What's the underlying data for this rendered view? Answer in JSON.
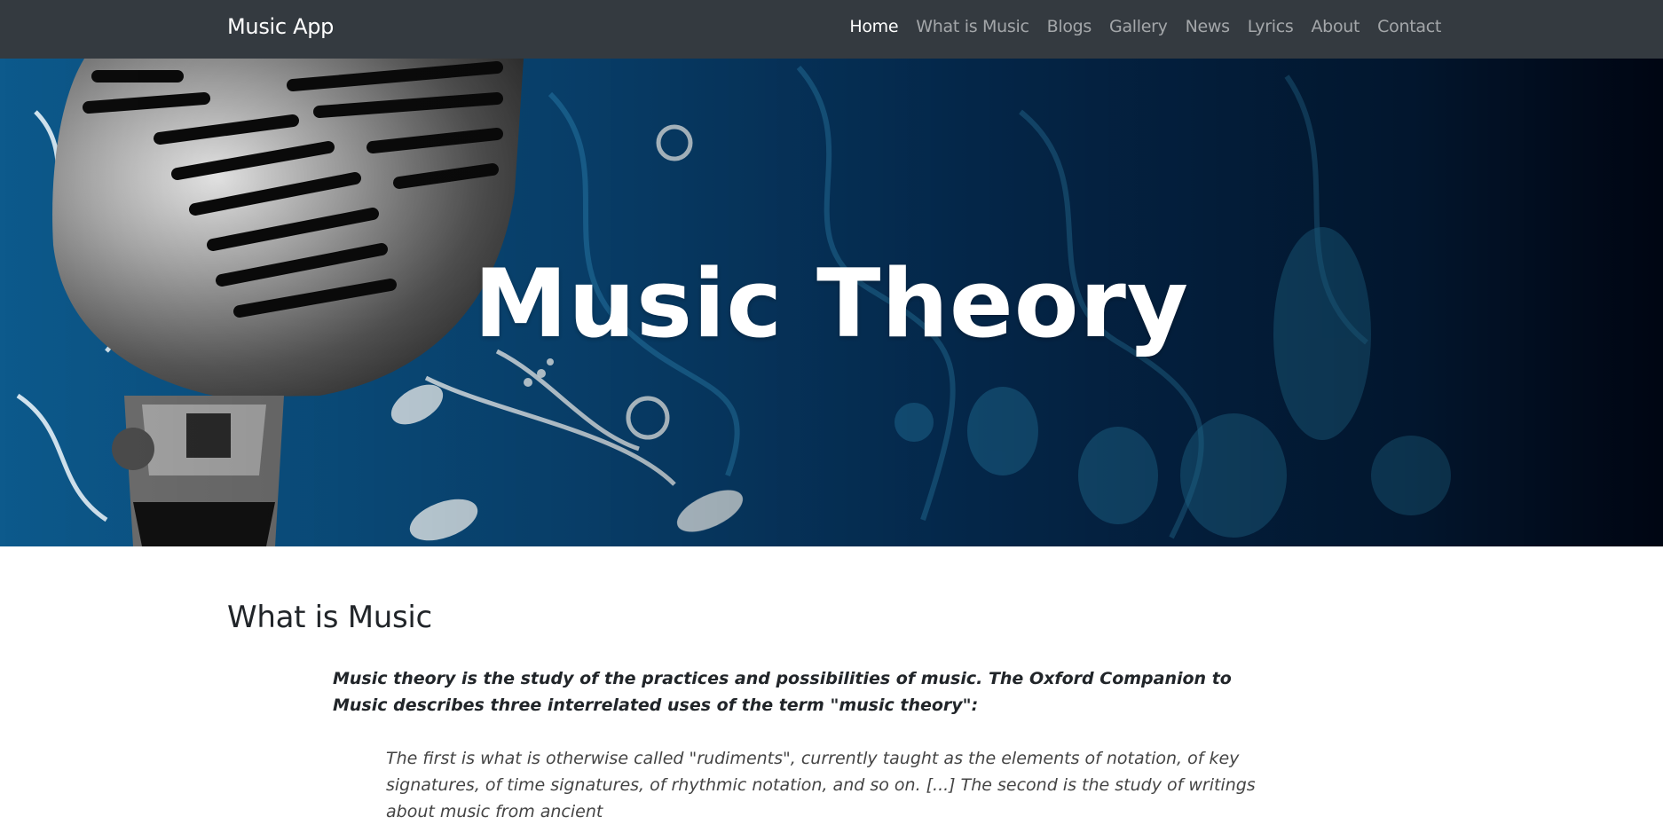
{
  "navbar": {
    "brand": "Music App",
    "links": [
      {
        "label": "Home",
        "active": true
      },
      {
        "label": "What is Music",
        "active": false
      },
      {
        "label": "Blogs",
        "active": false
      },
      {
        "label": "Gallery",
        "active": false
      },
      {
        "label": "News",
        "active": false
      },
      {
        "label": "Lyrics",
        "active": false
      },
      {
        "label": "About",
        "active": false
      },
      {
        "label": "Contact",
        "active": false
      }
    ]
  },
  "hero": {
    "title": "Music Theory"
  },
  "main": {
    "heading": "What is Music",
    "intro": "Music theory is the study of the practices and possibilities of music. The Oxford Companion to Music describes three interrelated uses of the term \"music theory\":",
    "quote": "The first is what is otherwise called \"rudiments\", currently taught as the elements of notation, of key signatures, of time signatures, of rhythmic notation, and so on. [...] The second is the study of writings about music from ancient"
  },
  "colors": {
    "navbar_bg": "#343a40",
    "hero_blue": "#0a4c80",
    "text": "#212529"
  }
}
